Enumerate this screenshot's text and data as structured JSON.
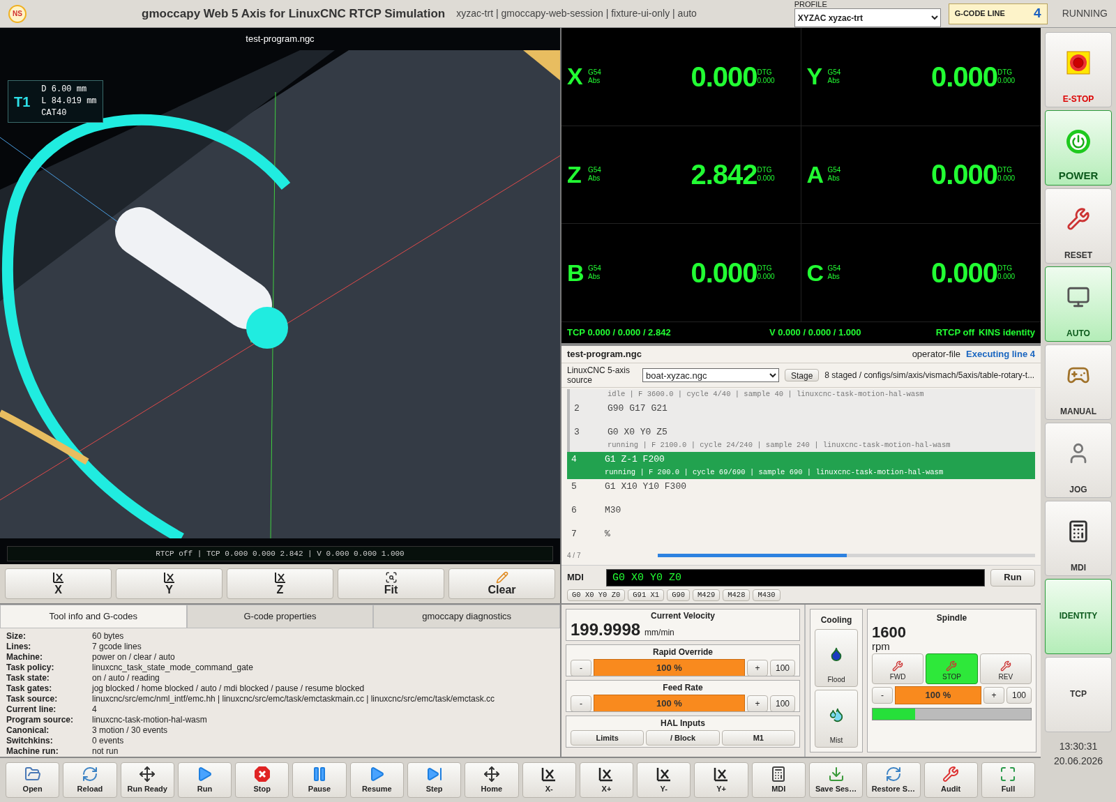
{
  "header": {
    "logo": "NS",
    "title": "gmoccapy Web 5 Axis for LinuxCNC RTCP Simulation",
    "subtitle": "xyzac-trt | gmoccapy-web-session | fixture-ui-only | auto",
    "profile_label": "PROFILE",
    "profile": "XYZAC xyzac-trt",
    "gcode_line_label": "G-CODE LINE",
    "gcode_line": "4",
    "status": "RUNNING"
  },
  "viewport": {
    "title": "test-program.ngc",
    "tool": {
      "number": "T1",
      "lines": [
        "D 6.00 mm",
        "L 84.019 mm",
        "CAT40"
      ]
    },
    "status_line": "RTCP off | TCP 0.000 0.000 2.842 | V 0.000 0.000 1.000",
    "view_buttons": [
      {
        "label": "X",
        "kind": "axis"
      },
      {
        "label": "Y",
        "kind": "axis"
      },
      {
        "label": "Z",
        "kind": "axis"
      },
      {
        "label": "Fit",
        "kind": "fit"
      },
      {
        "label": "Clear",
        "kind": "clear"
      }
    ]
  },
  "dro": {
    "axes": [
      {
        "letter": "X",
        "coord": "G54",
        "mode": "Abs",
        "value": "0.000",
        "dtg_label": "DTG",
        "dtg": "0.000"
      },
      {
        "letter": "Y",
        "coord": "G54",
        "mode": "Abs",
        "value": "0.000",
        "dtg_label": "DTG",
        "dtg": "0.000"
      },
      {
        "letter": "Z",
        "coord": "G54",
        "mode": "Abs",
        "value": "2.842",
        "dtg_label": "DTG",
        "dtg": "0.000"
      },
      {
        "letter": "A",
        "coord": "G54",
        "mode": "Abs",
        "value": "0.000",
        "dtg_label": "DTG",
        "dtg": "0.000"
      },
      {
        "letter": "B",
        "coord": "G54",
        "mode": "Abs",
        "value": "0.000",
        "dtg_label": "DTG",
        "dtg": "0.000"
      },
      {
        "letter": "C",
        "coord": "G54",
        "mode": "Abs",
        "value": "0.000",
        "dtg_label": "DTG",
        "dtg": "0.000"
      }
    ],
    "tcp": "TCP 0.000 / 0.000 / 2.842",
    "v": "V 0.000 / 0.000 / 1.000",
    "rtcp": "RTCP off",
    "kins": "KINS identity"
  },
  "program": {
    "file": "test-program.ngc",
    "source": "operator-file",
    "executing": "Executing line 4",
    "source_label": "LinuxCNC 5-axis source",
    "source_file": "boat-xyzac.ngc",
    "stage": "Stage",
    "staged": "8 staged / configs/sim/axis/vismach/5axis/table-rotary-t...",
    "lines": [
      {
        "info": "idle | F 3600.0 | cycle 4/40 | sample 40 | linuxcnc-task-motion-hal-wasm",
        "selected": false,
        "done": true
      },
      {
        "number": "2",
        "code": "G90 G17 G21",
        "selected": false,
        "done": true
      },
      {
        "number": "3",
        "code": "G0 X0 Y0 Z5",
        "info": "running | F 2100.0 | cycle 24/240 | sample 240 | linuxcnc-task-motion-hal-wasm",
        "selected": false,
        "done": true
      },
      {
        "number": "4",
        "code": "G1 Z-1 F200",
        "info": "running | F 200.0 | cycle 69/690 | sample 690 | linuxcnc-task-motion-hal-wasm",
        "selected": true,
        "done": false
      },
      {
        "number": "5",
        "code": "G1 X10 Y10 F300",
        "selected": false,
        "done": false
      },
      {
        "number": "6",
        "code": "M30",
        "selected": false,
        "done": false
      },
      {
        "number": "7",
        "code": "%",
        "selected": false,
        "done": false
      }
    ],
    "position": "4 / 7",
    "level": 0.5
  },
  "mdi": {
    "label": "MDI",
    "value": "G0 X0 Y0 Z0",
    "run": "Run",
    "history": [
      "G0 X0 Y0 Z0",
      "G91 X1",
      "G90",
      "M429",
      "M428",
      "M430"
    ]
  },
  "info": {
    "tabs": [
      {
        "label": "Tool info and G-codes",
        "selected": true
      },
      {
        "label": "G-code properties",
        "selected": false
      },
      {
        "label": "gmoccapy diagnostics",
        "selected": false
      }
    ],
    "rows": [
      {
        "label": "Size:",
        "value": "60 bytes"
      },
      {
        "label": "Lines:",
        "value": "7 gcode lines"
      },
      {
        "label": "Machine:",
        "value": "power on / clear / auto"
      },
      {
        "label": "Task policy:",
        "value": "linuxcnc_task_state_mode_command_gate"
      },
      {
        "label": "Task state:",
        "value": "on / auto / reading"
      },
      {
        "label": "Task gates:",
        "value": "jog blocked / home blocked / auto / mdi blocked / pause / resume blocked"
      },
      {
        "label": "Task source:",
        "value": "linuxcnc/src/emc/nml_intf/emc.hh | linuxcnc/src/emc/task/emctaskmain.cc | linuxcnc/src/emc/task/emctask.cc"
      },
      {
        "label": "Current line:",
        "value": "4"
      },
      {
        "label": "Program source:",
        "value": "linuxcnc-task-motion-hal-wasm"
      },
      {
        "label": "Canonical:",
        "value": "3 motion / 30 events"
      },
      {
        "label": "Switchkins:",
        "value": "0 events"
      },
      {
        "label": "Machine run:",
        "value": "not run"
      }
    ]
  },
  "velocity": {
    "title": "Current Velocity",
    "value": "199.9998",
    "unit": "mm/min"
  },
  "overrides": [
    {
      "title": "Rapid Override",
      "minus": "-",
      "value": "100 %",
      "plus": "+",
      "reset": "100",
      "level": 1
    },
    {
      "title": "Feed Rate",
      "minus": "-",
      "value": "100 %",
      "plus": "+",
      "reset": "100",
      "level": 1
    }
  ],
  "hal": {
    "title": "HAL Inputs",
    "buttons": [
      "Limits",
      "/ Block",
      "M1"
    ]
  },
  "cooling": {
    "title": "Cooling",
    "buttons": [
      {
        "label": "Flood",
        "kind": "flood"
      },
      {
        "label": "Mist",
        "kind": "mist"
      }
    ]
  },
  "spindle": {
    "title": "Spindle",
    "speed": "1600",
    "unit": "rpm",
    "buttons": [
      {
        "label": "FWD",
        "selected": false
      },
      {
        "label": "STOP",
        "selected": true
      },
      {
        "label": "REV",
        "selected": false
      }
    ],
    "minus": "-",
    "value": "100 %",
    "plus": "+",
    "reset": "100",
    "level": 1,
    "load": {
      "level": 0.27
    }
  },
  "modes": [
    {
      "label": "E-STOP",
      "kind": "estop",
      "selected": false
    },
    {
      "label": "POWER",
      "kind": "power",
      "selected": true
    },
    {
      "label": "RESET",
      "kind": "reset",
      "selected": false
    },
    {
      "label": "AUTO",
      "kind": "auto",
      "selected": true
    },
    {
      "label": "MANUAL",
      "kind": "manual",
      "selected": false
    },
    {
      "label": "JOG",
      "kind": "jog",
      "selected": false
    },
    {
      "label": "MDI",
      "kind": "mdi",
      "selected": false
    },
    {
      "label": "IDENTITY",
      "kind": "text",
      "selected": true
    },
    {
      "label": "TCP",
      "kind": "text",
      "selected": false
    }
  ],
  "clock": {
    "time": "13:30:31",
    "date": "20.06.2026"
  },
  "toolbar": [
    {
      "label": "Open",
      "kind": "open"
    },
    {
      "label": "Reload",
      "kind": "reload"
    },
    {
      "label": "Run Ready",
      "kind": "home"
    },
    {
      "label": "Run",
      "kind": "play"
    },
    {
      "label": "Stop",
      "kind": "stop"
    },
    {
      "label": "Pause",
      "kind": "pause"
    },
    {
      "label": "Resume",
      "kind": "play"
    },
    {
      "label": "Step",
      "kind": "step"
    },
    {
      "label": "Home",
      "kind": "home"
    },
    {
      "label": "X-",
      "kind": "axis"
    },
    {
      "label": "X+",
      "kind": "axis"
    },
    {
      "label": "Y-",
      "kind": "axis"
    },
    {
      "label": "Y+",
      "kind": "axis"
    },
    {
      "label": "MDI",
      "kind": "mdi"
    },
    {
      "label": "Save Ses…",
      "kind": "save"
    },
    {
      "label": "Restore S…",
      "kind": "reload"
    },
    {
      "label": "Audit",
      "kind": "audit"
    },
    {
      "label": "Full",
      "kind": "full"
    }
  ]
}
